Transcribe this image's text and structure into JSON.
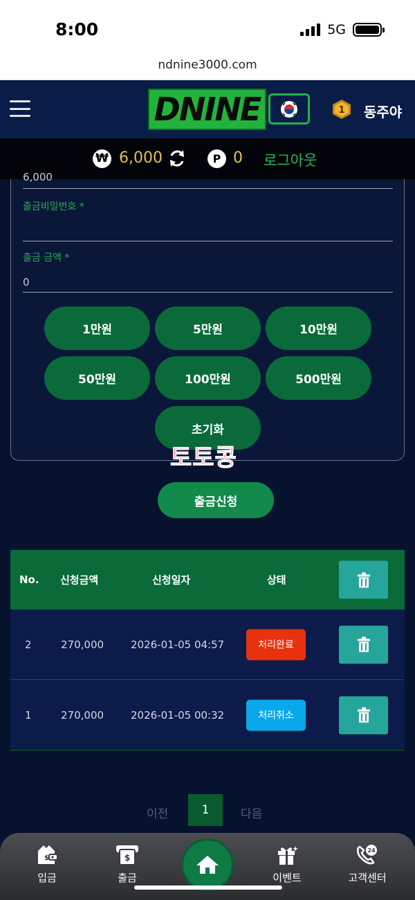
{
  "status_bar": {
    "time": "8:00",
    "network": "5G"
  },
  "browser": {
    "url": "ndnine3000.com"
  },
  "header": {
    "logo_text": "DNINE",
    "username": "동주야",
    "level": "1"
  },
  "balance": {
    "cash_symbol": "₩",
    "cash": "6,000",
    "point_symbol": "P",
    "points": "0",
    "logout": "로그아웃"
  },
  "form": {
    "partial_value": "6,000",
    "password_label": "출금비밀번호 *",
    "amount_label": "출금 금액 *",
    "amount_value": "0",
    "quick_amounts": [
      "1만원",
      "5만원",
      "10만원",
      "50만원",
      "100만원",
      "500만원"
    ],
    "reset_label": "초기화",
    "watermark": "토토콩",
    "submit_label": "출금신청"
  },
  "table": {
    "headers": {
      "no": "No.",
      "amount": "신청금액",
      "date": "신청일자",
      "status": "상태"
    },
    "rows": [
      {
        "no": "2",
        "amount": "270,000",
        "date": "2026-01-05 04:57",
        "status": "처리완료",
        "status_color": "#e8320e"
      },
      {
        "no": "1",
        "amount": "270,000",
        "date": "2026-01-05 00:32",
        "status": "처리취소",
        "status_color": "#0aa8ea"
      }
    ]
  },
  "pagination": {
    "prev": "이전",
    "current": "1",
    "next": "다음"
  },
  "bottom_nav": {
    "deposit": "입금",
    "withdraw": "출금",
    "events": "이벤트",
    "support": "고객센터",
    "home_icon": "home-icon"
  },
  "colors": {
    "accent_green": "#0a6a3a",
    "gold": "#e2c34b",
    "navy": "#0a1c48"
  }
}
